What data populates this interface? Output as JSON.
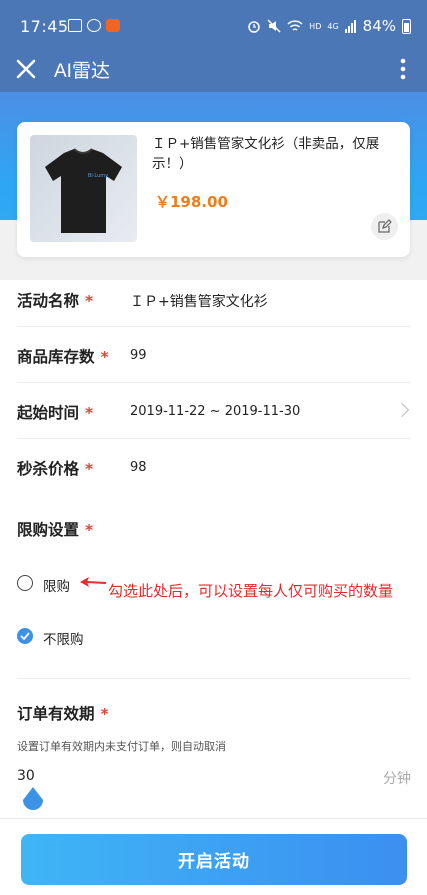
{
  "status": {
    "time": "17:45",
    "hd": "HD",
    "net": "4G",
    "battery": "84%"
  },
  "header": {
    "title": "AI雷达",
    "close_icon": "close-icon",
    "more_icon": "more-vertical-icon"
  },
  "product": {
    "name": "ＩＰ+销售管家文化衫（非卖品，仅展示！）",
    "price": "￥198.00",
    "shirt_text": "Bi·Lumy"
  },
  "form": {
    "activity_name": {
      "label": "活动名称",
      "required": "*",
      "value": "ＩＰ+销售管家文化衫"
    },
    "stock": {
      "label": "商品库存数",
      "required": "*",
      "value": "99"
    },
    "start_time": {
      "label": "起始时间",
      "required": "*",
      "value": "2019-11-22 ~ 2019-11-30"
    },
    "flash_price": {
      "label": "秒杀价格",
      "required": "*",
      "value": "98"
    },
    "limit": {
      "label": "限购设置",
      "required": "*",
      "options": [
        {
          "label": "限购",
          "checked": false
        },
        {
          "label": "不限购",
          "checked": true
        }
      ],
      "annotation": "勾选此处后，可以设置每人仅可购买的数量"
    },
    "order_validity": {
      "label": "订单有效期",
      "required": "*",
      "hint": "设置订单有效期内未支付订单，则自动取消",
      "value": "30",
      "unit": "分钟"
    }
  },
  "footer": {
    "start_label": "开启活动"
  },
  "colors": {
    "header": "#4c77b6",
    "accent": "#3c93e6",
    "price": "#ef7d1a",
    "required": "#e8413b",
    "annotation": "#e02d2d"
  }
}
